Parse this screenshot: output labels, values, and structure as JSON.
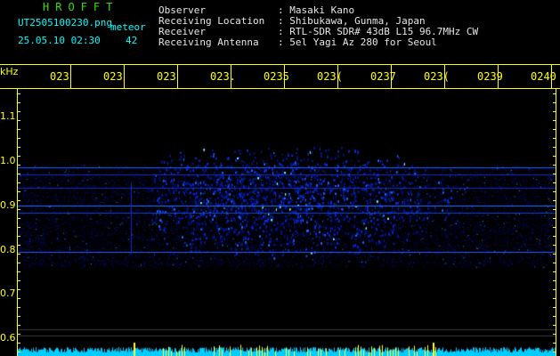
{
  "header": {
    "logo": "HROFFT",
    "filename": "UT2505100230.png",
    "subtitle": "meteor",
    "datetime": "25.05.10 02:30",
    "count": "42",
    "observer_label": "Observer",
    "location_label": "Receiving Location",
    "receiver_label": "Receiver",
    "antenna_label": "Receiving Antenna",
    "observer_value": ": Masaki Kano",
    "location_value": ": Shibukawa, Gunma, Japan",
    "receiver_value": ": RTL-SDR SDR# 43dB L15 96.7MHz CW",
    "antenna_value": ": 5el Yagi Az 280 for Seoul"
  },
  "axis": {
    "unit": "kHz",
    "y_ticks": [
      "1.1",
      "1.0",
      "0.9",
      "0.8",
      "0.7",
      "0.6"
    ],
    "time_ticks": [
      "023",
      "023",
      "023",
      "023.",
      "0235",
      "023(",
      "0237",
      "023(",
      "0239",
      "0240"
    ]
  },
  "colors": {
    "background": "#000000",
    "trace": "#0000ff",
    "bright": "#00ffff",
    "axis": "#ffff00",
    "logo": "#33e000"
  }
}
